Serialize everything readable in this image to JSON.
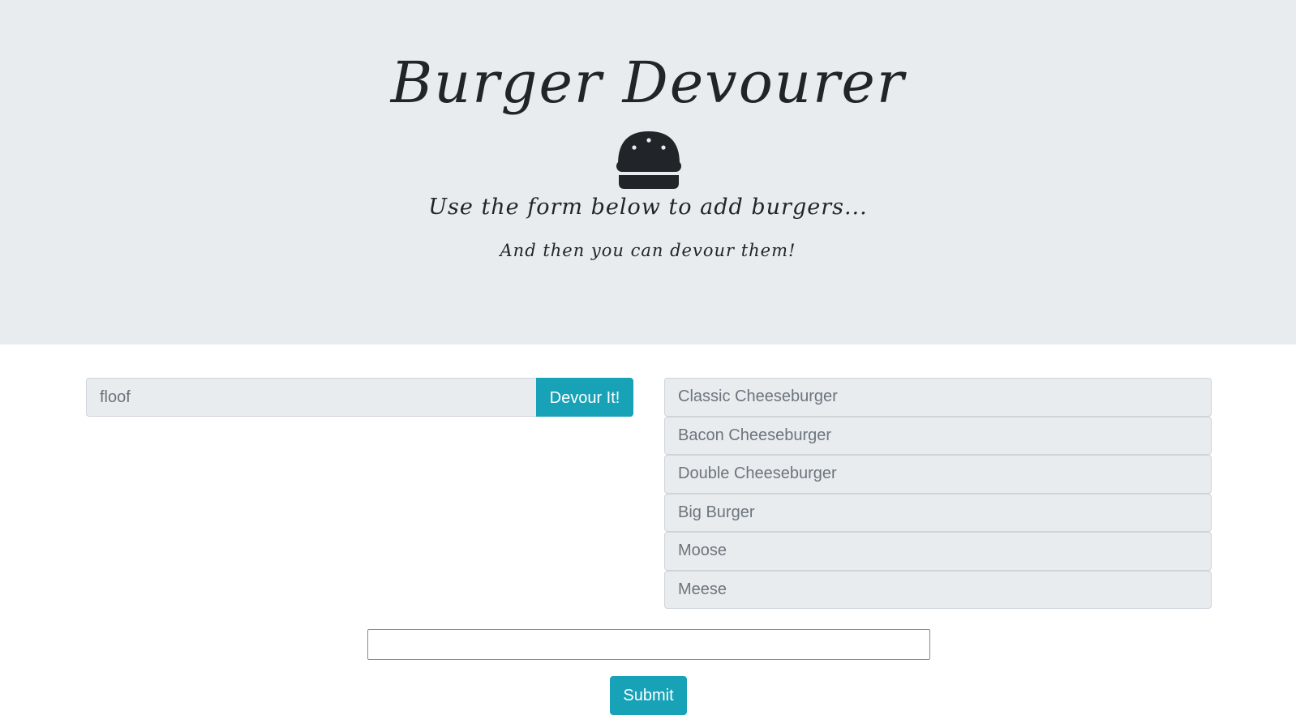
{
  "header": {
    "title": "Burger Devourer",
    "icon": "hamburger-icon",
    "lead": "Use the form below to add burgers...",
    "sublead": "And then you can devour them!"
  },
  "devour_list": [
    {
      "name": "floof",
      "button_label": "Devour It!"
    }
  ],
  "burger_list": [
    "Classic Cheeseburger",
    "Bacon Cheeseburger",
    "Double Cheeseburger",
    "Big Burger",
    "Moose",
    "Meese"
  ],
  "add_form": {
    "input_value": "",
    "submit_label": "Submit"
  },
  "colors": {
    "jumbotron_bg": "#e9ecef",
    "button_bg": "#17a2b8",
    "text_dark": "#212529",
    "text_muted": "#6c757d"
  }
}
